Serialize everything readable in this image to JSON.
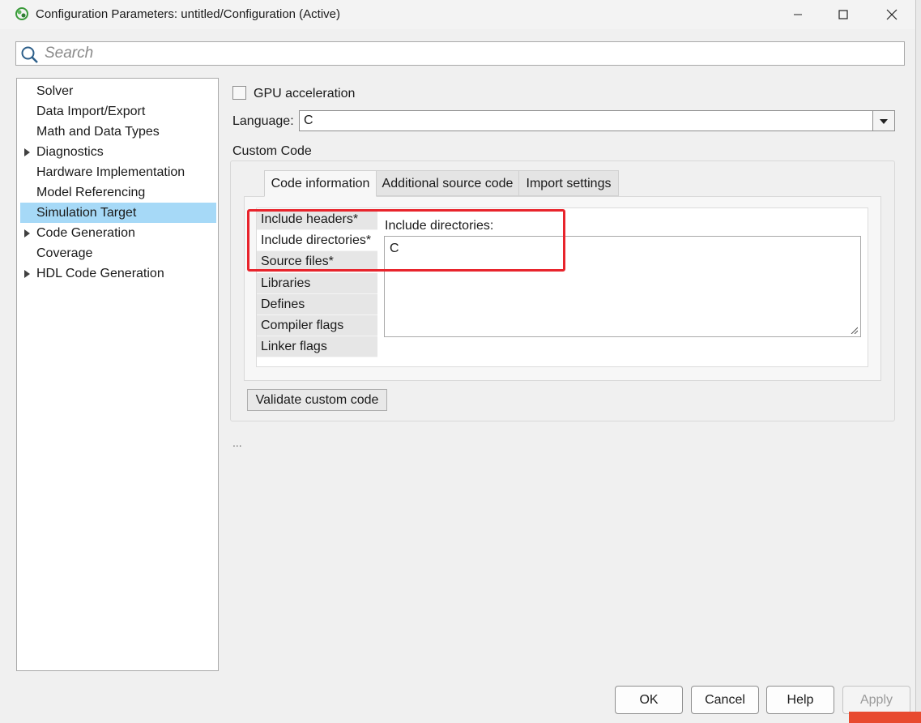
{
  "window": {
    "title": "Configuration Parameters: untitled/Configuration (Active)"
  },
  "search": {
    "placeholder": "Search"
  },
  "tree": {
    "items": [
      {
        "label": "Solver",
        "expandable": false,
        "selected": false
      },
      {
        "label": "Data Import/Export",
        "expandable": false,
        "selected": false
      },
      {
        "label": "Math and Data Types",
        "expandable": false,
        "selected": false
      },
      {
        "label": "Diagnostics",
        "expandable": true,
        "selected": false
      },
      {
        "label": "Hardware Implementation",
        "expandable": false,
        "selected": false
      },
      {
        "label": "Model Referencing",
        "expandable": false,
        "selected": false
      },
      {
        "label": "Simulation Target",
        "expandable": false,
        "selected": true
      },
      {
        "label": "Code Generation",
        "expandable": true,
        "selected": false
      },
      {
        "label": "Coverage",
        "expandable": false,
        "selected": false
      },
      {
        "label": "HDL Code Generation",
        "expandable": true,
        "selected": false
      }
    ]
  },
  "main": {
    "gpu_label": "GPU acceleration",
    "gpu_checked": false,
    "language_label": "Language:",
    "language_value": "C",
    "custom_code_label": "Custom Code",
    "tabs": [
      {
        "label": "Code information",
        "active": true
      },
      {
        "label": "Additional source code",
        "active": false
      },
      {
        "label": "Import settings",
        "active": false
      }
    ],
    "side_items": [
      {
        "label": "Include headers*",
        "active": false
      },
      {
        "label": "Include directories*",
        "active": true
      },
      {
        "label": "Source files*",
        "active": false
      },
      {
        "label": "Libraries",
        "active": false
      },
      {
        "label": "Defines",
        "active": false
      },
      {
        "label": "Compiler flags",
        "active": false
      },
      {
        "label": "Linker flags",
        "active": false
      }
    ],
    "include_dirs_label": "Include directories:",
    "include_dirs_value": "C",
    "validate_label": "Validate custom code",
    "ellipsis": "..."
  },
  "footer": {
    "ok": "OK",
    "cancel": "Cancel",
    "help": "Help",
    "apply": "Apply"
  },
  "colors": {
    "selection": "#a6d9f7",
    "highlight": "#e8242c"
  }
}
